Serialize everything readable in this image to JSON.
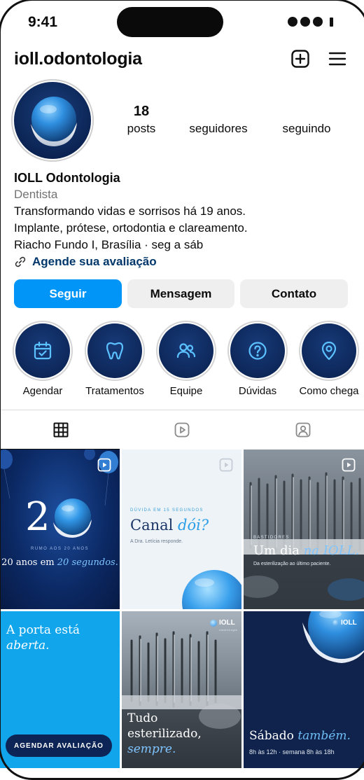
{
  "status": {
    "time": "9:41"
  },
  "header": {
    "username": "ioll.odontologia",
    "new_post_icon": "plus-square-icon",
    "menu_icon": "hamburger-menu-icon"
  },
  "stats": [
    {
      "number": "18",
      "label": "posts"
    },
    {
      "number": "",
      "label": "seguidores"
    },
    {
      "number": "",
      "label": "seguindo"
    }
  ],
  "bio": {
    "name": "IOLL Odontologia",
    "category": "Dentista",
    "lines": [
      "Transformando vidas e sorrisos há 19 anos.",
      "Implante, prótese, ortodontia e clareamento.",
      "Riacho Fundo I, Brasília · seg a sáb"
    ],
    "link": "Agende sua avaliação"
  },
  "actions": {
    "follow": "Seguir",
    "message": "Mensagem",
    "contact": "Contato"
  },
  "highlights": [
    {
      "label": "Agendar",
      "icon": "calendar-check-icon"
    },
    {
      "label": "Tratamentos",
      "icon": "tooth-icon"
    },
    {
      "label": "Equipe",
      "icon": "users-icon"
    },
    {
      "label": "Dúvidas",
      "icon": "question-circle-icon"
    },
    {
      "label": "Como chega",
      "icon": "map-pin-icon"
    }
  ],
  "tabs": [
    {
      "name": "grid",
      "icon": "grid-icon",
      "active": true
    },
    {
      "name": "reels",
      "icon": "reels-icon",
      "active": false
    },
    {
      "name": "tagged",
      "icon": "tagged-person-icon",
      "active": false
    }
  ],
  "posts": {
    "p1": {
      "big_number_a": "2",
      "kicker": "RUMO AOS 20 ANOS",
      "caption_a": "20 anos em ",
      "caption_b": "20 segundos."
    },
    "p2": {
      "kicker": "DÚVIDA EM 15 SEGUNDOS",
      "title_a": "Canal ",
      "title_b": "dói?",
      "sub": "A Dra. Letícia responde."
    },
    "p3": {
      "kicker": "BASTIDORES",
      "title_a": "Um dia ",
      "title_b": "na IOLL.",
      "sub": "Da esterilização ao último paciente."
    },
    "p4": {
      "title_a": "A porta está",
      "title_b": "aberta.",
      "cta": "AGENDAR AVALIAÇÃO"
    },
    "p5": {
      "logo": "IOLL",
      "logo_sub": "odontologia",
      "title_a": "Tudo",
      "title_b": "esterilizado,",
      "title_c": "sempre."
    },
    "p6": {
      "logo": "IOLL",
      "title_a": "Sábado ",
      "title_b": "também.",
      "sub": "8h às 12h · semana 8h às 18h"
    }
  },
  "colors": {
    "brand_blue": "#0095f6",
    "navy": "#0c2556",
    "link": "#00376b",
    "sky": "#0ea5e9"
  }
}
